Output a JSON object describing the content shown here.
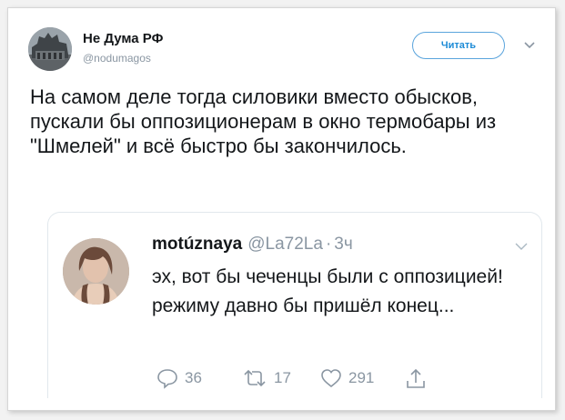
{
  "tweet": {
    "author_name": "Не Дума РФ",
    "author_handle": "@nodumagos",
    "follow_label": "Читать",
    "text": "На самом деле тогда силовики вместо обысков, пускали бы оппозиционерам в окно термобары из \"Шмелей\" и всё быстро бы закончилось."
  },
  "quoted": {
    "author_name": "motúznaya",
    "author_handle": "@La72La",
    "separator": "·",
    "time": "3ч",
    "text": "эх, вот бы чеченцы были с оппозицией! режиму давно бы пришёл конец...",
    "actions": {
      "replies": "36",
      "retweets": "17",
      "likes": "291"
    }
  },
  "colors": {
    "accent": "#1d8bd6",
    "muted": "#8a96a2",
    "text": "#14171a"
  },
  "icons": [
    "reply-icon",
    "retweet-icon",
    "like-icon",
    "share-icon",
    "chevron-down-icon"
  ]
}
